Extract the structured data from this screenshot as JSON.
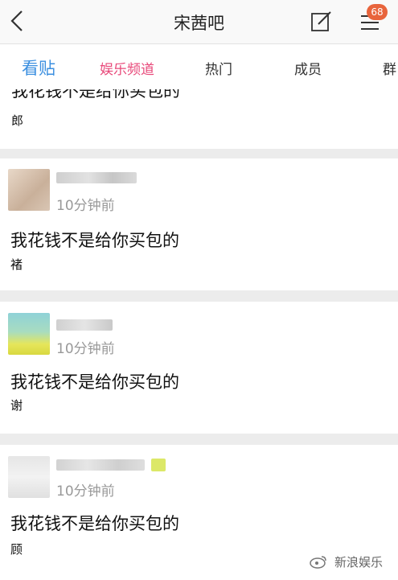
{
  "header": {
    "title": "宋茜吧",
    "badge_count": "68"
  },
  "tabs": [
    {
      "label": "看贴"
    },
    {
      "label": "娱乐频道"
    },
    {
      "label": "热门"
    },
    {
      "label": "成员"
    },
    {
      "label": "群"
    }
  ],
  "posts": [
    {
      "content": "我花钱不是给你买包的",
      "char": "郎"
    },
    {
      "time": "10分钟前",
      "content": "我花钱不是给你买包的",
      "char": "褚"
    },
    {
      "time": "10分钟前",
      "content": "我花钱不是给你买包的",
      "char": "谢"
    },
    {
      "time": "10分钟前",
      "content": "我花钱不是给你买包的",
      "char": "顾"
    }
  ],
  "watermark": {
    "text": "新浪娱乐"
  },
  "colors": {
    "accent": "#3b8fe0",
    "pink_tab": "#e8497a",
    "badge": "#e8643c"
  }
}
